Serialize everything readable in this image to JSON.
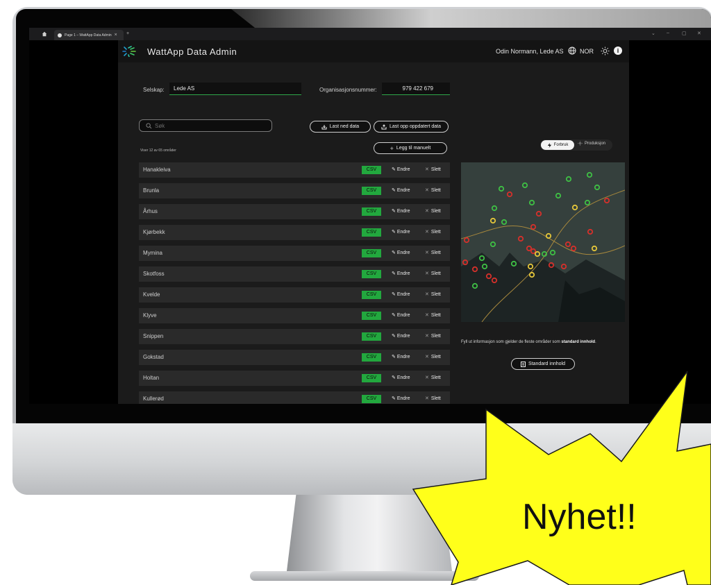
{
  "browser": {
    "tab_title": "Page 1 – WattApp Data Admin",
    "tab_close": "×",
    "new_tab": "+",
    "window_controls": [
      "⌄",
      "–",
      "▢",
      "✕"
    ]
  },
  "header": {
    "brand": "WattApp Data Admin",
    "user": "Odin Normann, Lede AS",
    "language": "NOR",
    "info_icon": "i"
  },
  "company": {
    "company_label": "Selskap:",
    "company_value": "Lede AS",
    "org_label": "Organisasjonsnummer:",
    "org_value": "979 422 679"
  },
  "search": {
    "placeholder": "Søk"
  },
  "actions": {
    "download": "Last ned data",
    "upload": "Last opp oppdatert data",
    "add_manual": "Legg til manuelt",
    "add_prefix": "+"
  },
  "list": {
    "count_text": "Viser 12 av 65 områder",
    "csv_label": "CSV",
    "edit_label": "Endre",
    "delete_label": "Slett",
    "rows": [
      {
        "name": "Hanakleiva"
      },
      {
        "name": "Brunla"
      },
      {
        "name": "Århus"
      },
      {
        "name": "Kjørbekk"
      },
      {
        "name": "Mymina"
      },
      {
        "name": "Skotfoss"
      },
      {
        "name": "Kvelde"
      },
      {
        "name": "Klyve"
      },
      {
        "name": "Snippen"
      },
      {
        "name": "Gokstad"
      },
      {
        "name": "Holtan"
      },
      {
        "name": "Kullerød"
      }
    ]
  },
  "toggle": {
    "active": "Forbruk",
    "inactive": "Produksjon"
  },
  "map_marker_colors": {
    "green": "#3fbf45",
    "red": "#d6302b",
    "yellow": "#e4c63a"
  },
  "info": {
    "text_prefix": "Fyll ut informasjon som gjelder de fleste områder som",
    "text_bold": "standard innhold",
    "text_suffix": ".",
    "button": "Standard innhold"
  },
  "burst": {
    "text": "Nyhet!!",
    "color": "#ffff1a"
  }
}
